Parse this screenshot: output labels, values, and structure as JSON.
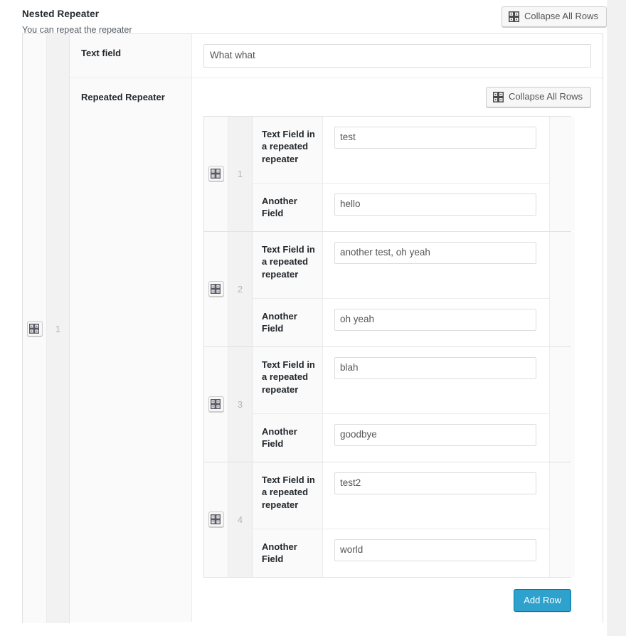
{
  "metabox": {
    "title": "Nested Repeater",
    "description": "You can repeat the repeater",
    "collapse_all_label": "Collapse All Rows"
  },
  "colors": {
    "accent_button": "#2ea2cc",
    "accent_button_border": "#0074a2",
    "panel_border": "#e1e1e1",
    "label_bg": "#fafafa",
    "number_bg": "#f2f2f2",
    "title_text": "#23282d"
  },
  "icons": {
    "grip": "drag-handle-icon",
    "collapse": "collapse-grid-icon"
  },
  "outer_repeater": {
    "rows": [
      {
        "number": "1",
        "fields": [
          {
            "label": "Text field",
            "type": "text",
            "value": "What what",
            "placeholder": ""
          },
          {
            "label": "Repeated Repeater",
            "type": "nested_repeater"
          }
        ]
      }
    ]
  },
  "inner_repeater": {
    "collapse_all_label": "Collapse All Rows",
    "add_row_label": "Add Row",
    "rows": [
      {
        "number": "1",
        "fields": [
          {
            "label": "Text Field in a repeated repeater",
            "value": "test",
            "placeholder": ""
          },
          {
            "label": "Another Field",
            "value": "hello",
            "placeholder": ""
          }
        ]
      },
      {
        "number": "2",
        "fields": [
          {
            "label": "Text Field in a repeated repeater",
            "value": "another test, oh yeah",
            "placeholder": ""
          },
          {
            "label": "Another Field",
            "value": "oh yeah",
            "placeholder": ""
          }
        ]
      },
      {
        "number": "3",
        "fields": [
          {
            "label": "Text Field in a repeated repeater",
            "value": "blah",
            "placeholder": ""
          },
          {
            "label": "Another Field",
            "value": "goodbye",
            "placeholder": ""
          }
        ]
      },
      {
        "number": "4",
        "fields": [
          {
            "label": "Text Field in a repeated repeater",
            "value": "test2",
            "placeholder": ""
          },
          {
            "label": "Another Field",
            "value": "world",
            "placeholder": ""
          }
        ]
      }
    ]
  }
}
